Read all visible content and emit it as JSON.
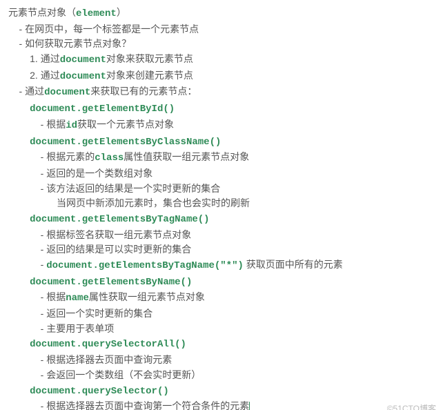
{
  "title_prefix": "元素节点对象（",
  "title_code": "element",
  "title_suffix": "）",
  "bullet1": "在网页中，每一个标签都是一个元素节点",
  "bullet2": "如何获取元素节点对象？",
  "sub1_num": "1.",
  "sub1_a": "通过",
  "sub1_code": "document",
  "sub1_b": "对象来获取元素节点",
  "sub2_num": "2.",
  "sub2_a": "通过",
  "sub2_code": "document",
  "sub2_b": "对象来创建元素节点",
  "bullet3_a": "通过",
  "bullet3_code": "document",
  "bullet3_b": "来获取已有的元素节点：",
  "m1": "document.getElementById()",
  "m1_d1_a": "根据",
  "m1_d1_code": "id",
  "m1_d1_b": "获取一个元素节点对象",
  "m2": "document.getElementsByClassName()",
  "m2_d1_a": "根据元素的",
  "m2_d1_code": "class",
  "m2_d1_b": "属性值获取一组元素节点对象",
  "m2_d2": "返回的是一个类数组对象",
  "m2_d3": "该方法返回的结果是一个实时更新的集合",
  "m2_d3_sub": "当网页中新添加元素时，集合也会实时的刷新",
  "m3": "document.getElementsByTagName()",
  "m3_d1": "根据标签名获取一组元素节点对象",
  "m3_d2": "返回的结果是可以实时更新的集合",
  "m3_d3_code": "document.getElementsByTagName(\"*\")",
  "m3_d3_txt": " 获取页面中所有的元素",
  "m4": "document.getElementsByName()",
  "m4_d1_a": "根据",
  "m4_d1_code": "name",
  "m4_d1_b": "属性获取一组元素节点对象",
  "m4_d2": "返回一个实时更新的集合",
  "m4_d3": "主要用于表单项",
  "m5": "document.querySelectorAll()",
  "m5_d1": "根据选择器去页面中查询元素",
  "m5_d2": "会返回一个类数组（不会实时更新）",
  "m6": "document.querySelector()",
  "m6_d1": "根据选择器去页面中查询第一个符合条件的元素",
  "watermark": "©51CTO博客"
}
